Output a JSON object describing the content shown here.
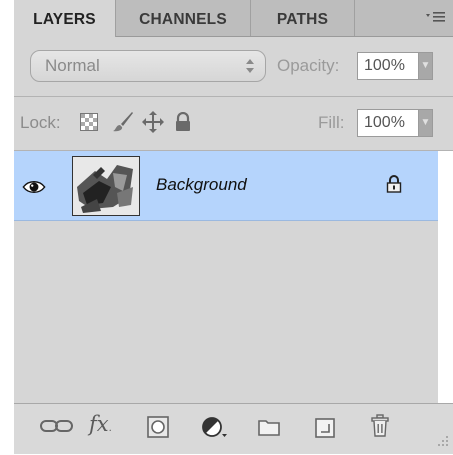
{
  "tabs": [
    {
      "label": "LAYERS"
    },
    {
      "label": "CHANNELS"
    },
    {
      "label": "PATHS"
    }
  ],
  "panel_menu_icon": "panel-menu-icon",
  "blend": {
    "mode": "Normal",
    "opacity_label": "Opacity:",
    "opacity_value": "100%"
  },
  "lock": {
    "label": "Lock:",
    "icons": [
      "lock-transparent-pixels-icon",
      "lock-image-pixels-icon",
      "lock-position-icon",
      "lock-all-icon"
    ],
    "fill_label": "Fill:",
    "fill_value": "100%"
  },
  "layers": [
    {
      "name": "Background",
      "visible": true,
      "locked": true,
      "selected": true
    }
  ],
  "bottom_icons": [
    "link-layers-icon",
    "layer-style-fx-icon",
    "add-mask-icon",
    "adjustment-layer-icon",
    "new-group-folder-icon",
    "new-layer-icon",
    "trash-icon"
  ],
  "colors": {
    "panel_bg": "#d6d6d6",
    "selected_row": "#b5d4fc",
    "tab_bar": "#bdbdbd"
  }
}
